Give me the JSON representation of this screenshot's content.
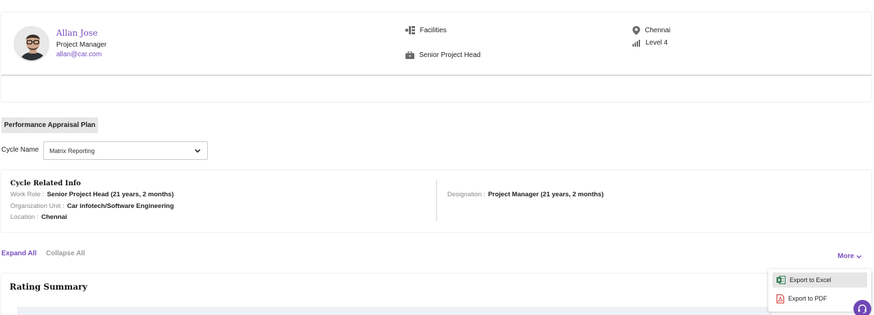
{
  "profile": {
    "name": "Allan Jose",
    "role": "Project Manager",
    "email": "allan@car.com",
    "department": "Facilities",
    "job_title": "Senior Project Head",
    "location": "Chennai",
    "level": "Level 4"
  },
  "plan": {
    "chip_label": "Performance Appraisal Plan",
    "cycle_label": "Cycle Name",
    "cycle_value": "Matrix Reporting"
  },
  "cycle_info": {
    "title": "Cycle Related Info",
    "work_role_label": "Work Role :",
    "work_role_value": "Senior Project Head (21 years, 2 months)",
    "org_unit_label": "Organization Unit :",
    "org_unit_value": "Car infotech/Software Engineering",
    "location_label": "Location :",
    "location_value": "Chennai",
    "designation_label": "Designation :",
    "designation_value": "Project Manager (21 years, 2 months)"
  },
  "actions": {
    "expand_all": "Expand All",
    "collapse_all": "Collapse All",
    "more": "More"
  },
  "rating": {
    "title": "Rating Summary"
  },
  "export_menu": {
    "excel": "Export to Excel",
    "pdf": "Export to PDF"
  },
  "colors": {
    "accent": "#7a4dc0",
    "help_button": "#6f47b6"
  },
  "icons": {
    "department": "org-chart-icon",
    "job_title": "briefcase-icon",
    "location": "location-pin-icon",
    "level": "signal-bars-icon",
    "cycle_dropdown": "chevron-down-icon",
    "more": "chevron-down-icon",
    "excel": "excel-file-icon",
    "pdf": "pdf-file-icon",
    "help": "headset-icon"
  }
}
